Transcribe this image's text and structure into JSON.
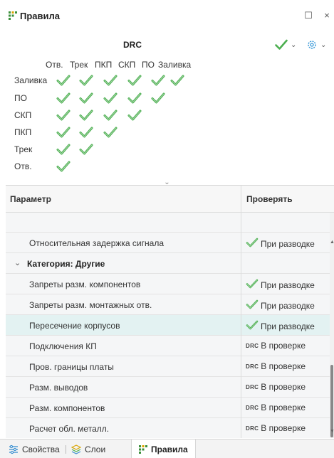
{
  "window": {
    "title": "Правила",
    "icon": "rules-grid-icon"
  },
  "drc": {
    "title": "DRC"
  },
  "matrix": {
    "columns": [
      "Отв.",
      "Трек",
      "ПКП",
      "СКП",
      "ПО",
      "Заливка"
    ],
    "rows": [
      {
        "label": "Заливка",
        "checks": 6
      },
      {
        "label": "ПО",
        "checks": 5
      },
      {
        "label": "СКП",
        "checks": 4
      },
      {
        "label": "ПКП",
        "checks": 3
      },
      {
        "label": "Трек",
        "checks": 2
      },
      {
        "label": "Отв.",
        "checks": 1
      }
    ],
    "check_color": "#4caf50"
  },
  "table": {
    "headers": {
      "param": "Параметр",
      "check": "Проверять"
    },
    "rows": [
      {
        "type": "blank",
        "name": "",
        "value": ""
      },
      {
        "type": "item",
        "name": "Относительная задержка сигнала",
        "value": "При разводке",
        "icon": "check"
      },
      {
        "type": "category",
        "name": "Категория: Другие"
      },
      {
        "type": "item",
        "name": "Запреты разм. компонентов",
        "value": "При разводке",
        "icon": "check"
      },
      {
        "type": "item",
        "name": "Запреты разм. монтажных отв.",
        "value": "При разводке",
        "icon": "check"
      },
      {
        "type": "item",
        "name": "Пересечение корпусов",
        "value": "При разводке",
        "icon": "check",
        "selected": true
      },
      {
        "type": "item",
        "name": "Подключения КП",
        "value": "В проверке",
        "icon": "drc"
      },
      {
        "type": "item",
        "name": "Пров. границы платы",
        "value": "В проверке",
        "icon": "drc"
      },
      {
        "type": "item",
        "name": "Разм. выводов",
        "value": "В проверке",
        "icon": "drc"
      },
      {
        "type": "item",
        "name": "Разм. компонентов",
        "value": "В проверке",
        "icon": "drc"
      },
      {
        "type": "item",
        "name": "Расчет обл. металл.",
        "value": "В проверке",
        "icon": "drc"
      }
    ],
    "drc_badge": "DRC"
  },
  "tabs": [
    {
      "label": "Свойства",
      "icon": "properties-icon",
      "active": false
    },
    {
      "label": "Слои",
      "icon": "layers-icon",
      "active": false
    },
    {
      "label": "Правила",
      "icon": "rules-grid-icon",
      "active": true
    }
  ],
  "colors": {
    "accent_check": "#4caf50",
    "selected_row": "#e3f2f2",
    "table_bg": "#f5f6f7"
  }
}
